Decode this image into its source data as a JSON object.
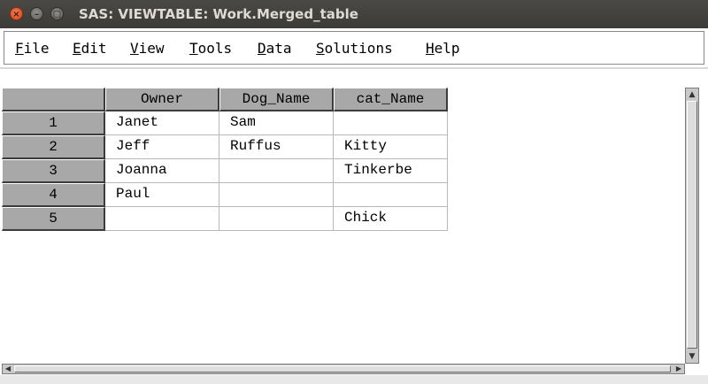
{
  "window": {
    "title": "SAS: VIEWTABLE: Work.Merged_table",
    "buttons": {
      "close": "×",
      "minimize": "–",
      "maximize": "□"
    }
  },
  "menu": [
    {
      "first": "F",
      "rest": "ile"
    },
    {
      "first": "E",
      "rest": "dit"
    },
    {
      "first": "V",
      "rest": "iew"
    },
    {
      "first": "T",
      "rest": "ools"
    },
    {
      "first": "D",
      "rest": "ata"
    },
    {
      "first": "S",
      "rest": "olutions"
    },
    {
      "first": "H",
      "rest": "elp"
    }
  ],
  "table": {
    "columns": [
      "Owner",
      "Dog_Name",
      "cat_Name"
    ],
    "rows": [
      {
        "num": "1",
        "cells": [
          "Janet",
          "Sam",
          ""
        ]
      },
      {
        "num": "2",
        "cells": [
          "Jeff",
          "Ruffus",
          "Kitty"
        ]
      },
      {
        "num": "3",
        "cells": [
          "Joanna",
          "",
          "Tinkerbe"
        ]
      },
      {
        "num": "4",
        "cells": [
          "Paul",
          "",
          ""
        ]
      },
      {
        "num": "5",
        "cells": [
          "",
          "",
          "Chick"
        ]
      }
    ]
  },
  "scrollbars": {
    "up": "▲",
    "down": "▼",
    "left": "◀",
    "right": "▶"
  }
}
